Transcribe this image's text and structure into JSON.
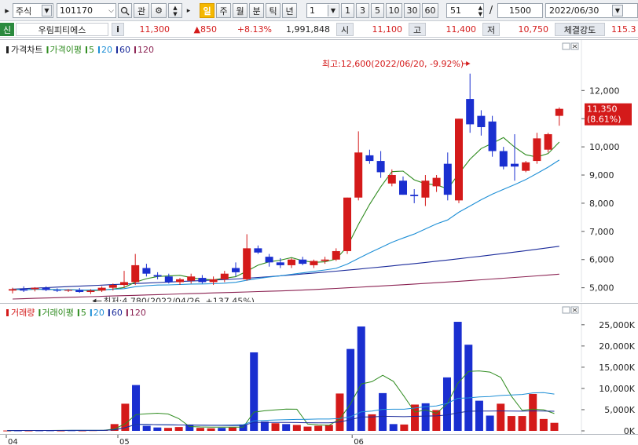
{
  "toolbar": {
    "market": "주식",
    "code": "101170",
    "search_icon": "magnifier-icon",
    "btn_gwan": "관",
    "periods": [
      "일",
      "주",
      "월",
      "분",
      "틱",
      "년"
    ],
    "selected_period": "일",
    "interval_value": "1",
    "ranges": [
      "1",
      "3",
      "5",
      "10",
      "30",
      "60"
    ],
    "count_value": "51",
    "count_sep": "/",
    "count_total": "1500",
    "date_value": "2022/06/30"
  },
  "quote": {
    "badge": "신",
    "name": "우림피티에스",
    "info_btn": "i",
    "price": "11,300",
    "change": "▲850",
    "change_pct": "+8.13%",
    "volume": "1,991,848",
    "open_label": "시",
    "open": "11,100",
    "high_label": "고",
    "high": "11,400",
    "low_label": "저",
    "low": "10,750",
    "strength_label": "체결강도",
    "strength": "115.3"
  },
  "price_panel": {
    "legend": [
      {
        "text": "가격차트",
        "color": "#222222"
      },
      {
        "text": "가격이평",
        "color": "#2e8b1e"
      },
      {
        "text": "5",
        "color": "#2e8b1e"
      },
      {
        "text": "20",
        "color": "#1e8fd6"
      },
      {
        "text": "60",
        "color": "#1a2a9a"
      },
      {
        "text": "120",
        "color": "#8b2252"
      }
    ],
    "high_note": "최고:12,600(2022/06/20, -9.92%)",
    "low_note": "최저:4,780(2022/04/26, +137.45%)",
    "current_tag": "11,350",
    "current_pct": "(8.61%)"
  },
  "volume_panel": {
    "legend": [
      {
        "text": "거래량",
        "color": "#d41a1a"
      },
      {
        "text": "거래이평",
        "color": "#2e8b1e"
      },
      {
        "text": "5",
        "color": "#2e8b1e"
      },
      {
        "text": "20",
        "color": "#1e8fd6"
      },
      {
        "text": "60",
        "color": "#1a2a9a"
      },
      {
        "text": "120",
        "color": "#8b2252"
      }
    ]
  },
  "colors": {
    "up": "#d41a1a",
    "down": "#1a2fd0",
    "ma5": "#2e8b1e",
    "ma20": "#1e8fd6",
    "ma60": "#1a2a9a",
    "ma120": "#8b2252"
  },
  "chart_data": [
    {
      "type": "candlestick",
      "title": "가격차트",
      "ylim": [
        4600,
        12900
      ],
      "y_ticks": [
        "5,000",
        "6,000",
        "7,000",
        "8,000",
        "9,000",
        "10,000",
        "11,000",
        "12,000"
      ],
      "y_tick_values": [
        5000,
        6000,
        7000,
        8000,
        9000,
        10000,
        11000,
        12000
      ],
      "x_tick_labels": [
        "04",
        "05",
        "06"
      ],
      "x_tick_index": [
        0,
        10,
        31
      ],
      "candles": [
        {
          "o": 4900,
          "h": 5000,
          "l": 4800,
          "c": 4950
        },
        {
          "o": 4950,
          "h": 5050,
          "l": 4850,
          "c": 4900
        },
        {
          "o": 4950,
          "h": 5020,
          "l": 4870,
          "c": 5000
        },
        {
          "o": 5000,
          "h": 5050,
          "l": 4880,
          "c": 4920
        },
        {
          "o": 4920,
          "h": 4980,
          "l": 4850,
          "c": 4900
        },
        {
          "o": 4900,
          "h": 4950,
          "l": 4850,
          "c": 4920
        },
        {
          "o": 4920,
          "h": 4990,
          "l": 4820,
          "c": 4850
        },
        {
          "o": 4850,
          "h": 4950,
          "l": 4780,
          "c": 4900
        },
        {
          "o": 4900,
          "h": 5050,
          "l": 4850,
          "c": 5000
        },
        {
          "o": 5000,
          "h": 5150,
          "l": 4900,
          "c": 5100
        },
        {
          "o": 5100,
          "h": 5600,
          "l": 5000,
          "c": 5200
        },
        {
          "o": 5200,
          "h": 6200,
          "l": 5100,
          "c": 5800
        },
        {
          "o": 5700,
          "h": 5850,
          "l": 5400,
          "c": 5500
        },
        {
          "o": 5450,
          "h": 5550,
          "l": 5300,
          "c": 5400
        },
        {
          "o": 5400,
          "h": 5500,
          "l": 5150,
          "c": 5200
        },
        {
          "o": 5200,
          "h": 5350,
          "l": 5100,
          "c": 5300
        },
        {
          "o": 5250,
          "h": 5500,
          "l": 5150,
          "c": 5400
        },
        {
          "o": 5350,
          "h": 5450,
          "l": 5150,
          "c": 5200
        },
        {
          "o": 5200,
          "h": 5400,
          "l": 5100,
          "c": 5300
        },
        {
          "o": 5300,
          "h": 5600,
          "l": 5200,
          "c": 5500
        },
        {
          "o": 5700,
          "h": 5900,
          "l": 5400,
          "c": 5550
        },
        {
          "o": 5300,
          "h": 6900,
          "l": 5250,
          "c": 6400
        },
        {
          "o": 6400,
          "h": 6500,
          "l": 6200,
          "c": 6250
        },
        {
          "o": 6100,
          "h": 6200,
          "l": 5750,
          "c": 5900
        },
        {
          "o": 5900,
          "h": 6050,
          "l": 5700,
          "c": 5800
        },
        {
          "o": 5800,
          "h": 6050,
          "l": 5700,
          "c": 6000
        },
        {
          "o": 6000,
          "h": 6100,
          "l": 5800,
          "c": 5850
        },
        {
          "o": 5800,
          "h": 6000,
          "l": 5700,
          "c": 5950
        },
        {
          "o": 5950,
          "h": 6100,
          "l": 5850,
          "c": 6000
        },
        {
          "o": 6000,
          "h": 6400,
          "l": 5950,
          "c": 6300
        },
        {
          "o": 6300,
          "h": 8200,
          "l": 6200,
          "c": 8200
        },
        {
          "o": 8200,
          "h": 10550,
          "l": 8100,
          "c": 9800
        },
        {
          "o": 9700,
          "h": 9900,
          "l": 9400,
          "c": 9500
        },
        {
          "o": 9500,
          "h": 9850,
          "l": 8900,
          "c": 9100
        },
        {
          "o": 8700,
          "h": 9200,
          "l": 8600,
          "c": 9000
        },
        {
          "o": 8800,
          "h": 8950,
          "l": 8300,
          "c": 8300
        },
        {
          "o": 8300,
          "h": 8500,
          "l": 8000,
          "c": 8250
        },
        {
          "o": 8200,
          "h": 9000,
          "l": 7900,
          "c": 8800
        },
        {
          "o": 8600,
          "h": 9000,
          "l": 8400,
          "c": 8900
        },
        {
          "o": 9400,
          "h": 9800,
          "l": 8100,
          "c": 8300
        },
        {
          "o": 8100,
          "h": 11000,
          "l": 8000,
          "c": 11000
        },
        {
          "o": 11700,
          "h": 12600,
          "l": 10500,
          "c": 10800
        },
        {
          "o": 11100,
          "h": 11300,
          "l": 10400,
          "c": 10700
        },
        {
          "o": 10900,
          "h": 11100,
          "l": 9650,
          "c": 9850
        },
        {
          "o": 9850,
          "h": 10000,
          "l": 9200,
          "c": 9300
        },
        {
          "o": 9400,
          "h": 10450,
          "l": 8800,
          "c": 9300
        },
        {
          "o": 9150,
          "h": 9500,
          "l": 9100,
          "c": 9450
        },
        {
          "o": 9500,
          "h": 10500,
          "l": 9400,
          "c": 10300
        },
        {
          "o": 9900,
          "h": 10500,
          "l": 9800,
          "c": 10450
        },
        {
          "o": 11100,
          "h": 11400,
          "l": 10750,
          "c": 11350
        }
      ]
    },
    {
      "type": "bar",
      "title": "거래량",
      "ylim": [
        0,
        27000
      ],
      "y_ticks": [
        "0K",
        "5,000K",
        "10,000K",
        "15,000K",
        "20,000K",
        "25,000K"
      ],
      "y_tick_values": [
        0,
        5000,
        10000,
        15000,
        20000,
        25000
      ],
      "values": [
        80,
        100,
        90,
        110,
        120,
        90,
        130,
        100,
        150,
        200,
        1600,
        6400,
        10800,
        1200,
        800,
        700,
        900,
        1500,
        700,
        600,
        700,
        800,
        1500,
        18500,
        2200,
        1800,
        1600,
        1400,
        1000,
        1200,
        1400,
        8800,
        19300,
        24600,
        3900,
        8900,
        1600,
        1500,
        6200,
        6500,
        4900,
        12600,
        25700,
        20300,
        7100,
        3600,
        6400,
        3500,
        3500,
        8700,
        2800,
        1900
      ]
    }
  ]
}
